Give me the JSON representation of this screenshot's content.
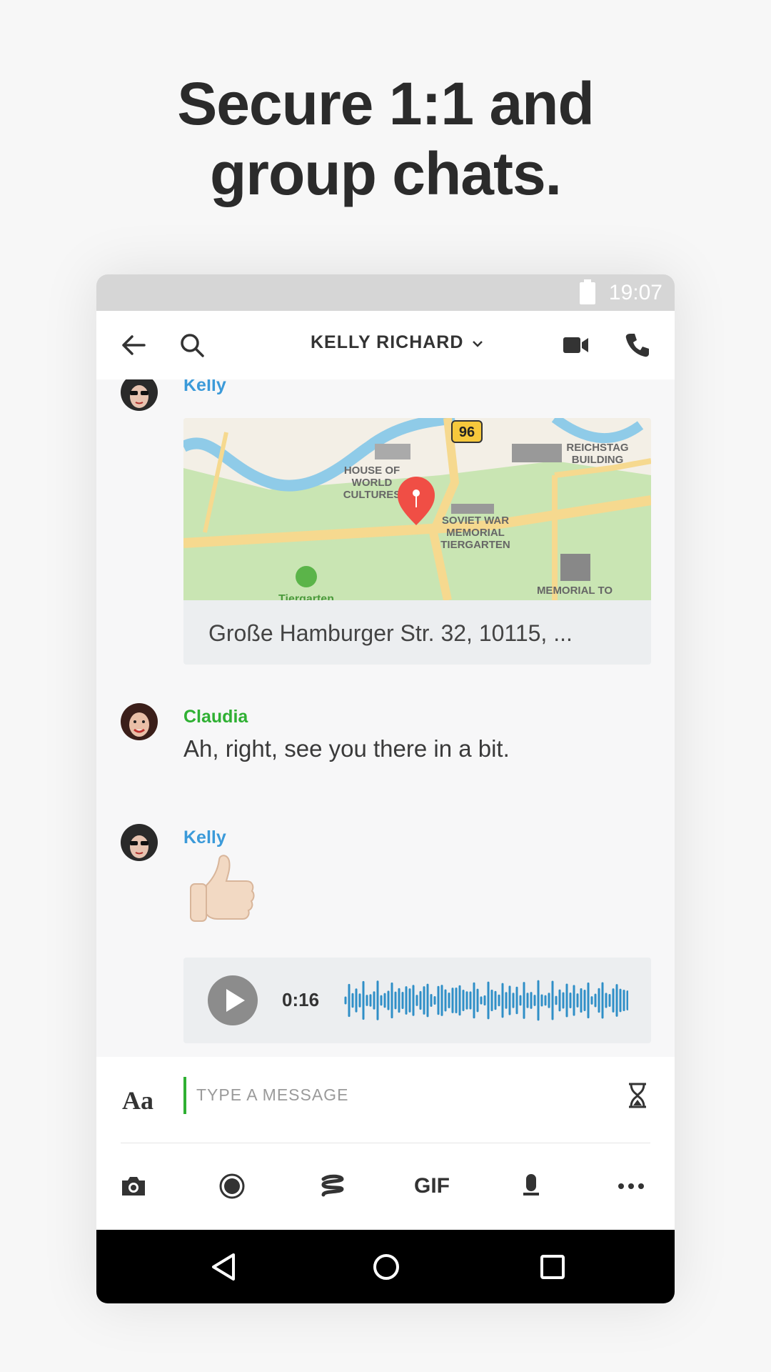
{
  "headline": {
    "line1": "Secure 1:1 and",
    "line2": "group chats."
  },
  "status_bar": {
    "time": "19:07",
    "icons": [
      "battery-icon"
    ]
  },
  "app_bar": {
    "title": "KELLY RICHARD",
    "icons": [
      "back-arrow-icon",
      "search-icon",
      "chevron-down-icon",
      "video-camera-icon",
      "phone-icon"
    ]
  },
  "messages": [
    {
      "sender": "Kelly",
      "sender_color": "#3b9ad9",
      "type": "location",
      "map_labels": {
        "house": "HOUSE OF",
        "house2": "WORLD",
        "house3": "CULTURES",
        "road": "96",
        "reichstag1": "REICHSTAG",
        "reichstag2": "BUILDING",
        "soviet1": "SOVIET WAR",
        "soviet2": "MEMORIAL",
        "soviet3": "TIERGARTEN",
        "memorial": "MEMORIAL TO",
        "park": "Tiergarten"
      },
      "address": "Große Hamburger Str. 32, 10115, ..."
    },
    {
      "sender": "Claudia",
      "sender_color": "#2fb033",
      "type": "text",
      "text": "Ah, right, see you there in a bit."
    },
    {
      "sender": "Kelly",
      "sender_color": "#3b9ad9",
      "type": "emoji",
      "emoji": "👍🏻"
    },
    {
      "type": "audio",
      "duration": "0:16"
    }
  ],
  "composer": {
    "format_label": "Aa",
    "placeholder": "TYPE A MESSAGE",
    "timer_icon": "hourglass-icon",
    "tools": [
      "camera-icon",
      "record-icon",
      "sketch-icon",
      "gif-icon",
      "microphone-icon",
      "more-icon"
    ],
    "gif_label": "GIF"
  },
  "nav_bar": {
    "icons": [
      "nav-back-icon",
      "nav-home-icon",
      "nav-recents-icon"
    ]
  },
  "colors": {
    "accent_green": "#2fb033",
    "accent_blue": "#3b9ad9",
    "pin": "#f04e45"
  }
}
